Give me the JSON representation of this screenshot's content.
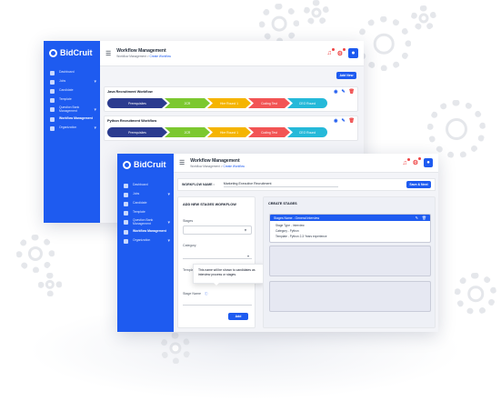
{
  "brand": {
    "name": "BidCruit"
  },
  "colors": {
    "primary": "#1e5bf0",
    "danger": "#ef4444"
  },
  "back_window": {
    "title": "Workflow Management",
    "breadcrumb": {
      "root": "Workflow Management",
      "sep": ">",
      "current": "Create Workflow"
    },
    "sidebar": [
      {
        "label": "Dashboard",
        "icon": "dashboard-icon"
      },
      {
        "label": "Jobs",
        "icon": "briefcase-icon",
        "chevron": "▾"
      },
      {
        "label": "Candidate",
        "icon": "user-icon"
      },
      {
        "label": "Template",
        "icon": "file-icon"
      },
      {
        "label": "Question Bank Management",
        "icon": "book-icon",
        "chevron": "▾"
      },
      {
        "label": "Workflow Management",
        "icon": "workflow-icon",
        "active": true
      },
      {
        "label": "Organization",
        "icon": "building-icon",
        "chevron": "▾"
      }
    ],
    "add_new_label": "Add New",
    "workflows": [
      {
        "title": "Java Recruitment Workflow",
        "stages": [
          "Prerequisites",
          "2CR",
          "Hire Round 1",
          "Coding Test",
          "CEO Round"
        ]
      },
      {
        "title": "Python Recruitment Workflow",
        "stages": [
          "Prerequisites",
          "2CR",
          "Hire Round 1",
          "Coding Test",
          "CEO Round"
        ]
      }
    ],
    "stage_colors": [
      "#2b3b8f",
      "#7cc82f",
      "#f5b400",
      "#f25454",
      "#25b9d9"
    ]
  },
  "front_window": {
    "title": "Workflow Management",
    "breadcrumb": {
      "root": "Workflow Management",
      "sep": ">",
      "current": "Create Workflow"
    },
    "sidebar": [
      {
        "label": "Dashboard",
        "icon": "dashboard-icon"
      },
      {
        "label": "Jobs",
        "icon": "briefcase-icon",
        "chevron": "▾"
      },
      {
        "label": "Candidate",
        "icon": "user-icon"
      },
      {
        "label": "Template",
        "icon": "file-icon"
      },
      {
        "label": "Question Bank Management",
        "icon": "book-icon",
        "chevron": "▾"
      },
      {
        "label": "Workflow Management",
        "icon": "workflow-icon",
        "active": true
      },
      {
        "label": "Organization",
        "icon": "building-icon",
        "chevron": "▾"
      }
    ],
    "workflow_name_label": "WORKFLOW NAME :",
    "workflow_name_value": "Marketing Executive Recruitment",
    "save_next_label": "Save & Next",
    "add_panel": {
      "title": "ADD NEW STAGES WORKFLOW",
      "stages_label": "Stages",
      "category_label": "Category",
      "template_label": "Templat",
      "tooltip": "This name will be shown to candidates as interview process or stages.",
      "stage_name_label": "Stage Name",
      "add_label": "Add"
    },
    "create_panel": {
      "title": "CREATE STAGES",
      "stage_card": {
        "header": "Stages Name - General Interview",
        "lines": [
          "Stage Type - Interview",
          "Category - Python",
          "Template - Python 2-3 Years experience"
        ]
      }
    }
  }
}
